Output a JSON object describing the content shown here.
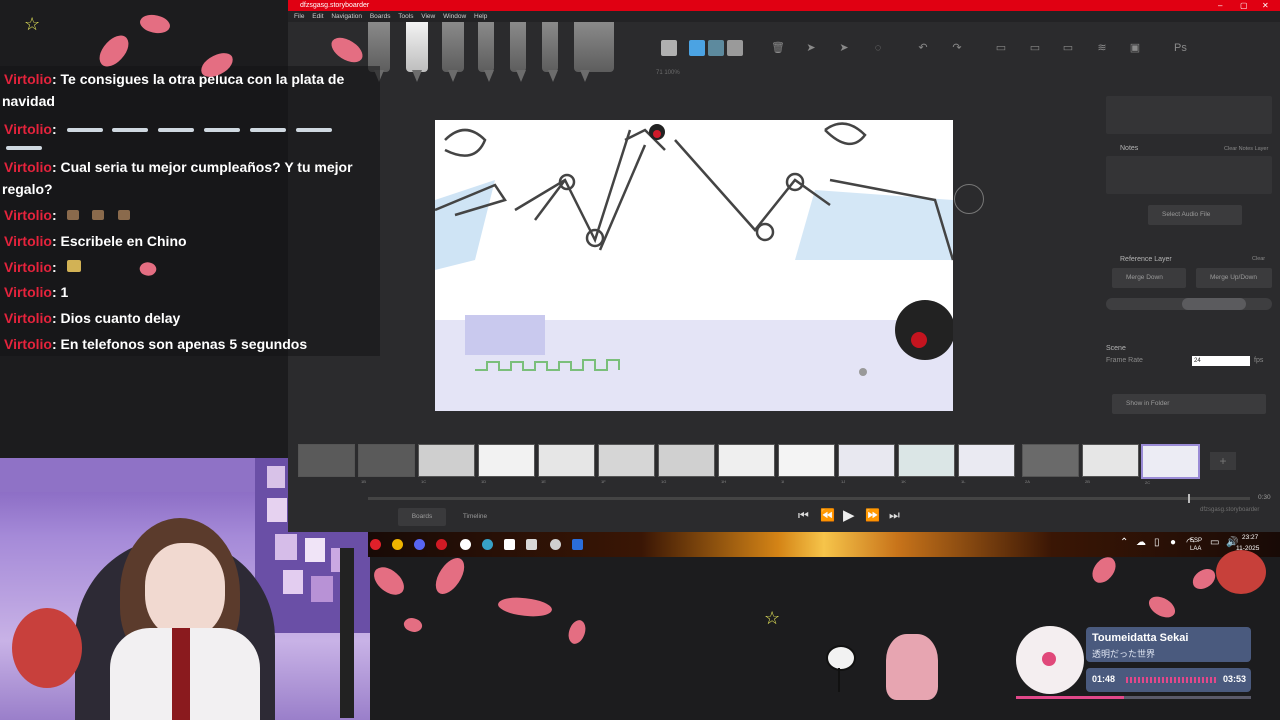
{
  "app": {
    "title": "dfzsgasg.storyboarder",
    "window_controls": [
      "–",
      "▢",
      "✕"
    ],
    "menu": [
      "File",
      "Edit",
      "Navigation",
      "Boards",
      "Tools",
      "View",
      "Window",
      "Help"
    ],
    "zoom_readout": "71 100%",
    "colors": {
      "red": "#e00012",
      "swatch_gray": "#b0b0b0",
      "swatch_blue": "#4ba3e3",
      "swatch_teal": "#5d8a9e",
      "swatch_light": "#9a9a9a"
    },
    "toolbar_icons": [
      "trash-icon",
      "add-board-icon",
      "move-icon",
      "lasso-icon",
      "undo-icon",
      "redo-icon",
      "layout-1-icon",
      "layout-2-icon",
      "layout-3-icon",
      "layers-icon",
      "image-icon",
      "photoshop-icon"
    ]
  },
  "panel": {
    "notes_label": "Notes",
    "clear_notes": "Clear Notes Layer",
    "select_audio": "Select Audio File",
    "reference_layer": "Reference Layer",
    "clear": "Clear",
    "merge_down": "Merge Down",
    "merge_up_down": "Merge Up/Down",
    "scene_label": "Scene",
    "frame_rate_label": "Frame Rate",
    "frame_rate_value": "24",
    "fps": "fps",
    "show_in_folder": "Show in Folder"
  },
  "timeline": {
    "tabs": [
      "Boards",
      "Timeline"
    ],
    "time_end": "0:30",
    "file_label": "dfzsgasg.storyboarder",
    "thumb_labels": [
      "1A",
      "1B",
      "1C",
      "1D",
      "1E",
      "1F",
      "1G",
      "1H",
      "1I",
      "1J",
      "1K",
      "1L",
      "2A",
      "2B",
      "2C"
    ],
    "playhead_progress": 0.93
  },
  "chat": {
    "messages": [
      {
        "user": "Virtolio",
        "text": ": Te consigues la otra peluca con la plata de"
      },
      {
        "user": "",
        "text": "navidad"
      },
      {
        "user": "Virtolio",
        "text": ":"
      },
      {
        "user": "Virtolio",
        "text": ": Cual seria tu mejor cumpleaños? Y tu mejor"
      },
      {
        "user": "",
        "text": "regalo?"
      },
      {
        "user": "Virtolio",
        "text": ":"
      },
      {
        "user": "Virtolio",
        "text": ": Escribele en Chino"
      },
      {
        "user": "Virtolio",
        "text": ":"
      },
      {
        "user": "Virtolio",
        "text": ": 1"
      },
      {
        "user": "Virtolio",
        "text": ": Dios cuanto delay"
      },
      {
        "user": "Virtolio",
        "text": ": En telefonos son apenas 5 segundos"
      }
    ]
  },
  "taskbar": {
    "lang": "ESP",
    "layout": "LAA",
    "time": "23:27",
    "date": "11-2025",
    "icons": [
      "youtube-icon",
      "chrome-icon",
      "discord-icon",
      "opera-icon",
      "obs-icon",
      "edge-icon",
      "app-icon",
      "app2-icon",
      "settings-icon",
      "folder-icon"
    ]
  },
  "music": {
    "title": "Toumeidatta Sekai",
    "subtitle": "透明だった世界",
    "current": "01:48",
    "total": "03:53",
    "progress": 0.46
  }
}
